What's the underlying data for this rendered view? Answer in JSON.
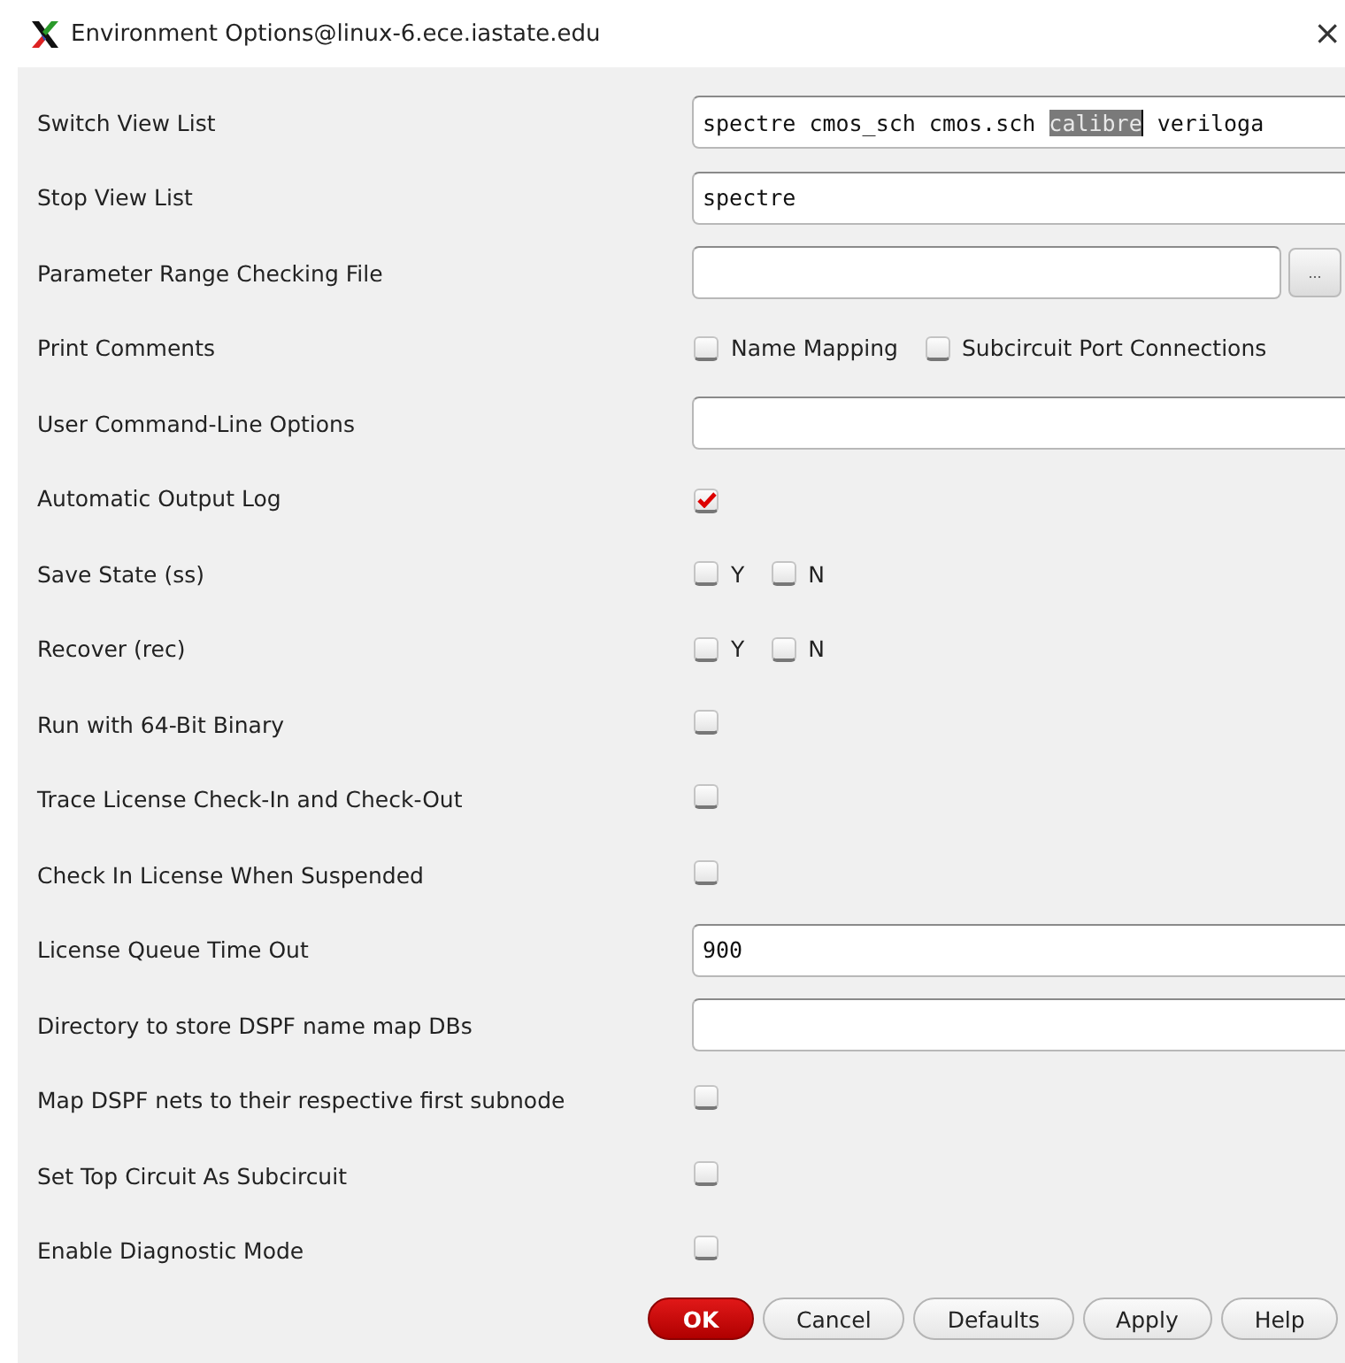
{
  "window": {
    "title": "Environment Options@linux-6.ece.iastate.edu",
    "close": "×"
  },
  "rows": [
    {
      "kind": "text",
      "label": "Switch View List",
      "value_parts": [
        {
          "text": "spectre cmos_sch cmos.sch ",
          "selected": false
        },
        {
          "text": "calibre",
          "selected": true
        },
        {
          "text": " veriloga",
          "selected": false
        }
      ]
    },
    {
      "kind": "text",
      "label": "Stop View List",
      "value_parts": [
        {
          "text": "spectre",
          "selected": false
        }
      ]
    },
    {
      "kind": "file",
      "label": "Parameter Range Checking File",
      "browse": "..."
    },
    {
      "kind": "checks",
      "label": "Print Comments",
      "options": [
        {
          "label": "Name Mapping",
          "checked": false
        },
        {
          "label": "Subcircuit Port Connections",
          "checked": false
        }
      ]
    },
    {
      "kind": "text",
      "label": "User Command-Line Options"
    },
    {
      "kind": "check",
      "label": "Automatic Output Log",
      "checked": true
    },
    {
      "kind": "checks",
      "label": "Save State (ss)",
      "options": [
        {
          "label": "Y",
          "checked": false
        },
        {
          "label": "N",
          "checked": false
        }
      ]
    },
    {
      "kind": "checks",
      "label": "Recover (rec)",
      "options": [
        {
          "label": "Y",
          "checked": false
        },
        {
          "label": "N",
          "checked": false
        }
      ]
    },
    {
      "kind": "check",
      "label": "Run with 64-Bit Binary",
      "checked": false
    },
    {
      "kind": "check",
      "label": "Trace License Check-In and Check-Out",
      "checked": false
    },
    {
      "kind": "check",
      "label": "Check In License When Suspended",
      "checked": false
    },
    {
      "kind": "text",
      "label": "License Queue Time Out",
      "value_parts": [
        {
          "text": "900",
          "selected": false
        }
      ]
    },
    {
      "kind": "text",
      "label": "Directory to store DSPF name map DBs"
    },
    {
      "kind": "check",
      "label": "Map DSPF nets to their respective first subnode",
      "checked": false
    },
    {
      "kind": "check",
      "label": "Set Top Circuit As Subcircuit",
      "checked": false
    },
    {
      "kind": "check",
      "label": "Enable Diagnostic Mode",
      "checked": false
    }
  ],
  "buttons": [
    {
      "label": "OK",
      "primary": true
    },
    {
      "label": "Cancel",
      "primary": false
    },
    {
      "label": "Defaults",
      "primary": false
    },
    {
      "label": "Apply",
      "primary": false
    },
    {
      "label": "Help",
      "primary": false
    }
  ]
}
